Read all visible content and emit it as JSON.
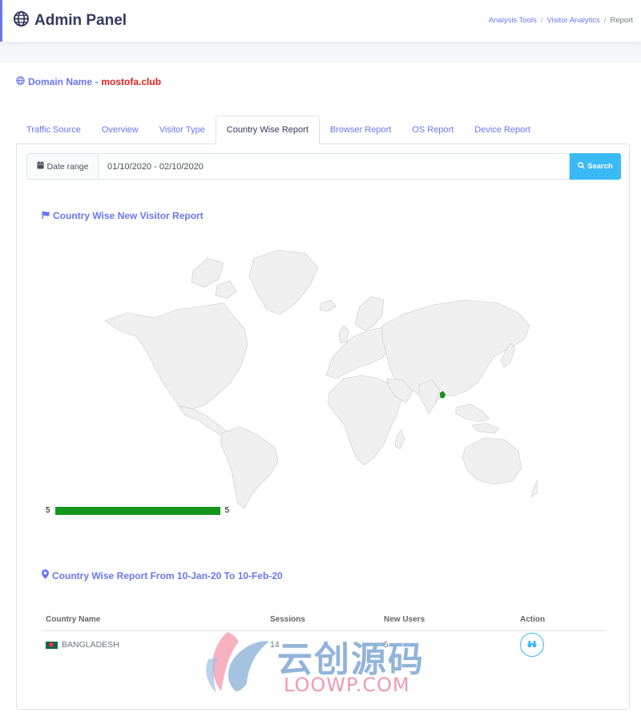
{
  "header": {
    "title": "Admin Panel",
    "breadcrumb": [
      "Analysis Tools",
      "Visitor Analytics",
      "Report"
    ]
  },
  "domain": {
    "label": "Domain Name -",
    "value": "mostofa.club"
  },
  "tabs": [
    {
      "label": "Traffic Source",
      "active": false
    },
    {
      "label": "Overview",
      "active": false
    },
    {
      "label": "Visitor Type",
      "active": false
    },
    {
      "label": "Country Wise Report",
      "active": true
    },
    {
      "label": "Browser Report",
      "active": false
    },
    {
      "label": "OS Report",
      "active": false
    },
    {
      "label": "Device Report",
      "active": false
    }
  ],
  "filter": {
    "label": "Date range",
    "value": "01/10/2020 - 02/10/2020",
    "button": "Search"
  },
  "map_section": {
    "title": "Country Wise New Visitor Report",
    "highlighted_country": "Bangladesh",
    "legend": {
      "min": "5",
      "max": "5",
      "color": "#13961a"
    }
  },
  "table_section": {
    "title": "Country Wise Report From 10-Jan-20 To 10-Feb-20",
    "columns": [
      "Country Name",
      "Sessions",
      "New Users",
      "Action"
    ],
    "rows": [
      {
        "country": "BANGLADESH",
        "sessions": "14",
        "new_users": "5"
      }
    ]
  },
  "watermark": {
    "line1": "云创源码",
    "line2": "LOOWP.COM"
  },
  "colors": {
    "primary": "#6777ef",
    "info": "#3abaf4",
    "danger": "#e0211c",
    "success": "#13961a"
  }
}
